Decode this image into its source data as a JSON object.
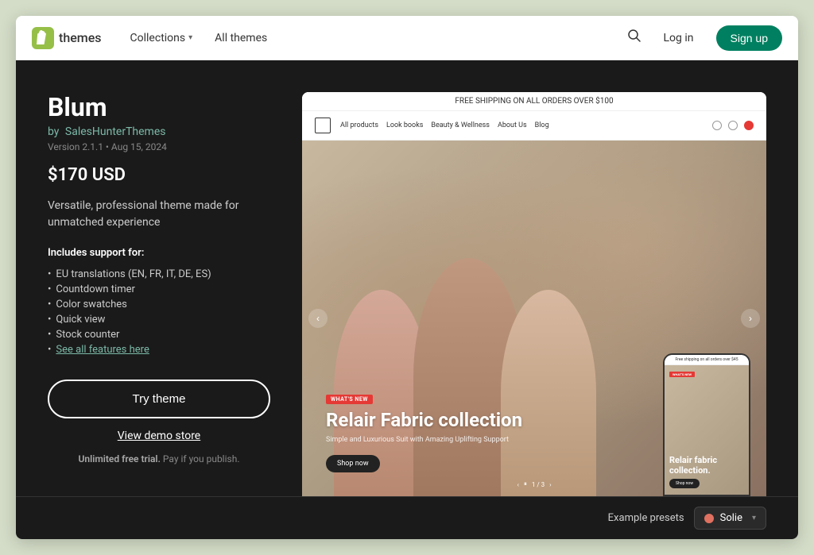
{
  "nav": {
    "logo_text": "themes",
    "links": [
      {
        "label": "Collections",
        "has_dropdown": true
      },
      {
        "label": "All themes",
        "has_dropdown": false
      }
    ],
    "login_label": "Log in",
    "signup_label": "Sign up"
  },
  "theme": {
    "title": "Blum",
    "author_prefix": "by",
    "author": "SalesHunterThemes",
    "version": "Version 2.1.1 • Aug 15, 2024",
    "price": "$170 USD",
    "description": "Versatile, professional theme made for unmatched experience",
    "includes_title": "Includes support for:",
    "features": [
      "EU translations (EN, FR, IT, DE, ES)",
      "Countdown timer",
      "Color swatches",
      "Quick view",
      "Stock counter",
      "See all features here"
    ],
    "try_theme_label": "Try theme",
    "view_demo_label": "View demo store",
    "unlimited_text": "Unlimited free trial.",
    "unlimited_subtext": " Pay if you publish."
  },
  "preview": {
    "announcement": "FREE SHIPPING ON ALL ORDERS OVER $100",
    "nav_links": [
      "All products",
      "Look books",
      "Beauty & Wellness",
      "About Us",
      "Blog"
    ],
    "hero": {
      "badge": "WHAT'S NEW",
      "title": "Relair Fabric collection",
      "subtitle": "Simple and Luxurious Suit with Amazing Uplifting Support",
      "shop_button": "Shop now",
      "pagination": "1 / 3"
    }
  },
  "mobile_preview": {
    "announcement": "Free shipping on all orders over $45",
    "badge": "WHAT'S NEW",
    "title": "Relair fabric collection.",
    "shop_button": "Shop now"
  },
  "bottom_bar": {
    "presets_label": "Example presets",
    "preset_name": "Solie",
    "preset_color": "#e07060"
  }
}
